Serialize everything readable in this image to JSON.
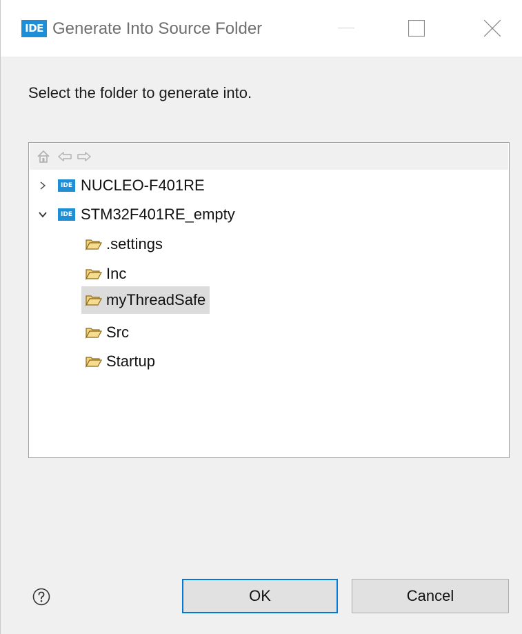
{
  "window": {
    "logo_text": "IDE",
    "title": "Generate Into Source Folder"
  },
  "instruction": "Select the folder to generate into.",
  "nav": {
    "home_icon": "home-icon",
    "back_icon": "back-arrow-icon",
    "forward_icon": "forward-arrow-icon"
  },
  "tree": {
    "projects": [
      {
        "label": "NUCLEO-F401RE",
        "logo": "IDE",
        "expanded": false
      },
      {
        "label": "STM32F401RE_empty",
        "logo": "IDE",
        "expanded": true
      }
    ],
    "folders": [
      {
        "label": ".settings",
        "selected": false
      },
      {
        "label": "Inc",
        "selected": false
      },
      {
        "label": "myThreadSafe",
        "selected": true
      },
      {
        "label": "Src",
        "selected": false
      },
      {
        "label": "Startup",
        "selected": false
      }
    ]
  },
  "buttons": {
    "ok": "OK",
    "cancel": "Cancel",
    "help_icon": "help-icon"
  },
  "colors": {
    "accent": "#0078d7",
    "logo_blue": "#1e8fd6",
    "folder": "#e8b84a",
    "selection": "#dcdcdc"
  }
}
